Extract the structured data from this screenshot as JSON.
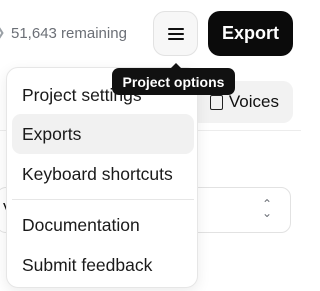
{
  "header": {
    "remaining_text": "51,643 remaining",
    "menu_button_icon": "hamburger-menu-icon",
    "export_label": "Export"
  },
  "tooltip": {
    "label": "Project options"
  },
  "background": {
    "voices_label": "Voices",
    "voices_icon": "document-icon",
    "select_value": "V",
    "select_icon": "chevron-up-down-icon"
  },
  "menu": {
    "items": [
      {
        "label": "Project settings"
      },
      {
        "label": "Exports"
      },
      {
        "label": "Keyboard shortcuts"
      },
      {
        "label": "Documentation"
      },
      {
        "label": "Submit feedback"
      }
    ]
  },
  "colors": {
    "accent_dark": "#0b0b0b",
    "muted_text": "#6b6f76",
    "hover_bg": "#f1f1f1"
  }
}
